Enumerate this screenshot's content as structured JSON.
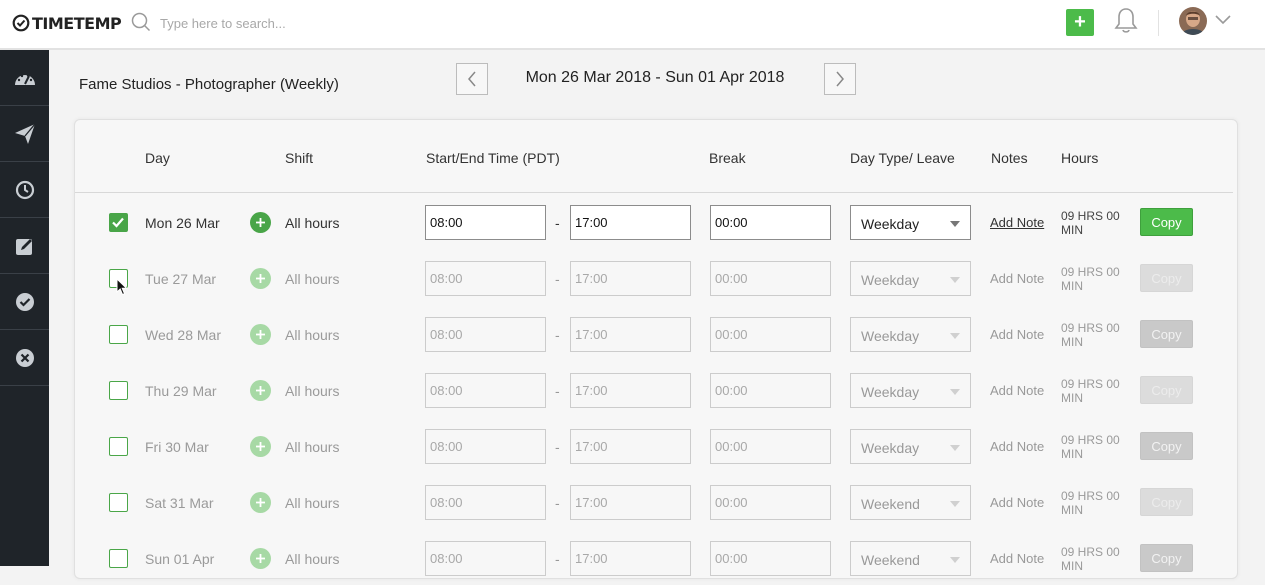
{
  "app": {
    "logo_text": "TIMETEMP"
  },
  "search": {
    "placeholder": "Type here to search..."
  },
  "header": {
    "add_label": "+"
  },
  "page": {
    "title": "Fame Studios - Photographer (Weekly)",
    "date_range": "Mon 26 Mar 2018 - Sun 01 Apr 2018"
  },
  "table": {
    "headers": {
      "day": "Day",
      "shift": "Shift",
      "time": "Start/End Time (PDT)",
      "break": "Break",
      "daytype": "Day Type/ Leave",
      "notes": "Notes",
      "hours": "Hours"
    },
    "dash": "-",
    "rows": [
      {
        "day": "Mon 26 Mar",
        "shift": "All hours",
        "start": "08:00",
        "end": "17:00",
        "break": "00:00",
        "daytype": "Weekday",
        "note": "Add Note",
        "hours": "09 HRS 00 MIN",
        "copy": "Copy",
        "checked": true
      },
      {
        "day": "Tue 27 Mar",
        "shift": "All hours",
        "start": "08:00",
        "end": "17:00",
        "break": "00:00",
        "daytype": "Weekday",
        "note": "Add Note",
        "hours": "09 HRS 00 MIN",
        "copy": "Copy",
        "checked": false
      },
      {
        "day": "Wed 28 Mar",
        "shift": "All hours",
        "start": "08:00",
        "end": "17:00",
        "break": "00:00",
        "daytype": "Weekday",
        "note": "Add Note",
        "hours": "09 HRS 00 MIN",
        "copy": "Copy",
        "checked": false
      },
      {
        "day": "Thu 29 Mar",
        "shift": "All hours",
        "start": "08:00",
        "end": "17:00",
        "break": "00:00",
        "daytype": "Weekday",
        "note": "Add Note",
        "hours": "09 HRS 00 MIN",
        "copy": "Copy",
        "checked": false
      },
      {
        "day": "Fri 30 Mar",
        "shift": "All hours",
        "start": "08:00",
        "end": "17:00",
        "break": "00:00",
        "daytype": "Weekday",
        "note": "Add Note",
        "hours": "09 HRS 00 MIN",
        "copy": "Copy",
        "checked": false
      },
      {
        "day": "Sat 31 Mar",
        "shift": "All hours",
        "start": "08:00",
        "end": "17:00",
        "break": "00:00",
        "daytype": "Weekend",
        "note": "Add Note",
        "hours": "09 HRS 00 MIN",
        "copy": "Copy",
        "checked": false
      },
      {
        "day": "Sun 01 Apr",
        "shift": "All hours",
        "start": "08:00",
        "end": "17:00",
        "break": "00:00",
        "daytype": "Weekend",
        "note": "Add Note",
        "hours": "09 HRS 00 MIN",
        "copy": "Copy",
        "checked": false
      }
    ]
  },
  "colors": {
    "accent": "#4cbb4a",
    "sidebar": "#1f2429",
    "sidebar_icon": "#c9ced3"
  },
  "sidebar_icons": [
    "dashboard-icon",
    "paper-plane-icon",
    "clock-icon",
    "edit-icon",
    "check-circle-icon",
    "close-circle-icon"
  ]
}
